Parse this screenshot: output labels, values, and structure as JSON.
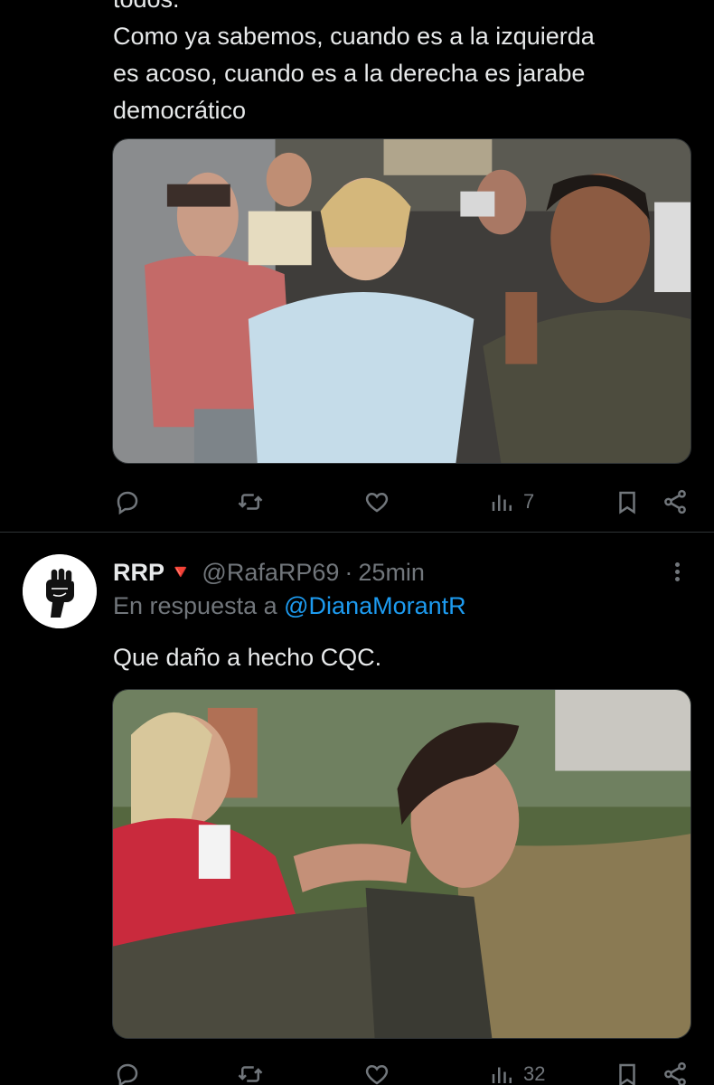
{
  "tweet1": {
    "text": "todos.\nComo ya sabemos, cuando es a la izquierda\nes acoso, cuando es a la derecha es jarabe\ndemocrático",
    "media_icon": "photo",
    "stats": {
      "views": "7"
    }
  },
  "tweet2": {
    "display_name": "RRP",
    "name_emoji": "🔻",
    "handle": "@RafaRP69",
    "dot": "·",
    "time": "25min",
    "reply_prefix": "En respuesta a",
    "reply_to": "@DianaMorantR",
    "text": "Que daño a hecho CQC.",
    "avatar_icon": "raised-fist",
    "stats": {
      "views": "32"
    }
  },
  "icons": {
    "reply": "reply-icon",
    "retweet": "retweet-icon",
    "like": "like-icon",
    "views": "views-icon",
    "bookmark": "bookmark-icon",
    "share": "share-icon",
    "more": "more-icon"
  },
  "colors": {
    "background": "#000000",
    "text": "#e7e9ea",
    "muted": "#71767b",
    "link": "#1d9bf0",
    "separator": "#2f3336"
  }
}
